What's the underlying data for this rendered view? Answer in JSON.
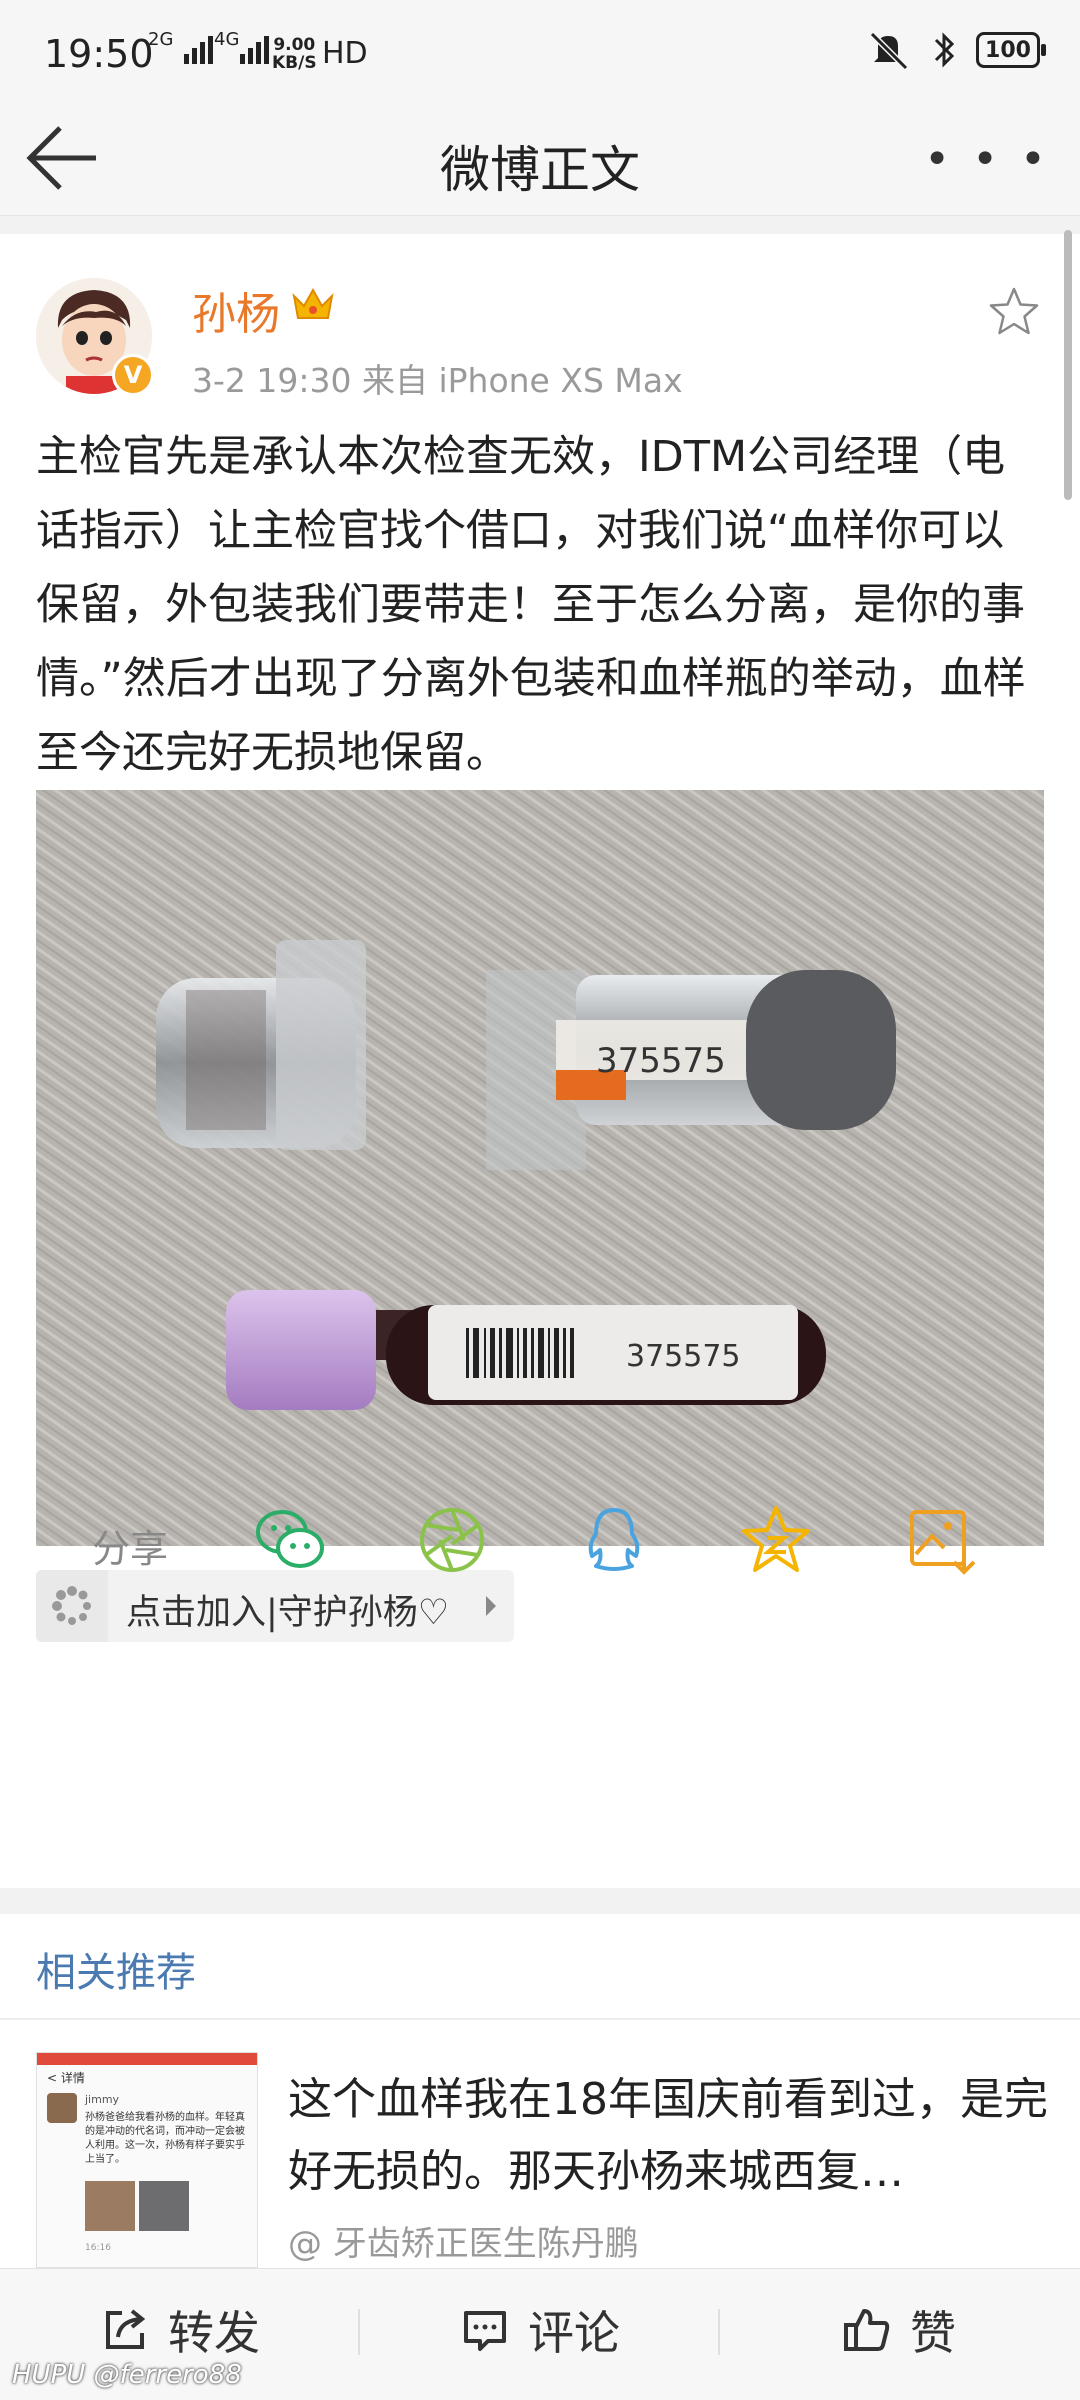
{
  "status_bar": {
    "time": "19:50",
    "net1": "2G",
    "net2": "4G",
    "speed_value": "9.00",
    "speed_unit": "KB/S",
    "hd": "HD",
    "battery": "100"
  },
  "nav": {
    "title": "微博正文"
  },
  "post": {
    "username": "孙杨",
    "verified_badge": "V",
    "meta": "3-2 19:30   来自 iPhone XS Max",
    "text": "主检官先是承认本次检查无效，IDTM公司经理（电话指示）让主检官找个借口，对我们说“血样你可以保留，外包装我们要带走！至于怎么分离，是你的事情。”然后才出现了分离外包装和血样瓶的举动，血样至今还完好无损地保留。",
    "photo": {
      "container_label": "375575",
      "tube_label": "375575"
    },
    "topic": "点击加入|守护孙杨♡"
  },
  "share": {
    "label": "分享",
    "targets": [
      "wechat-icon",
      "moments-icon",
      "qq-icon",
      "qzone-icon",
      "save-image-icon"
    ]
  },
  "related": {
    "title": "相关推荐",
    "item": {
      "text": "这个血样我在18年国庆前看到过，是完好无损的。那天孙杨来城西复…",
      "source": "@ 牙齿矫正医生陈丹鹏",
      "thumb_header": "详情",
      "thumb_user": "jimmy",
      "thumb_caption": "孙杨爸爸给我看孙杨的血样。年轻真的是冲动的代名词，而冲动一定会被人利用。这一次，孙杨有样子要实乎上当了。",
      "thumb_time": "16:16"
    }
  },
  "bottom_bar": {
    "repost": "转发",
    "comment": "评论",
    "like": "赞"
  },
  "watermark": "HUPU @ferrero88",
  "colors": {
    "username": "#e8792a",
    "link_blue": "#4a7ab0",
    "wechat_green": "#2aae67",
    "moments_green": "#8bc34a",
    "qq_blue": "#4aa3df",
    "qzone_yellow": "#f5b400",
    "save_orange": "#f0a020"
  }
}
